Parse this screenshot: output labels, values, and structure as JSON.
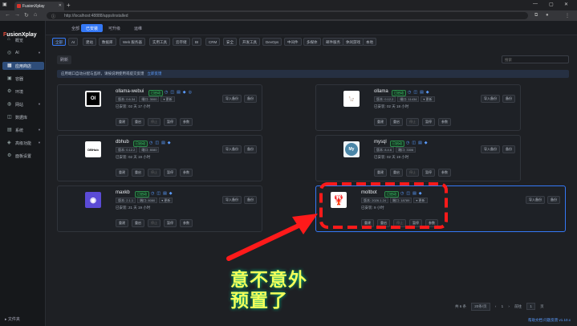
{
  "browser": {
    "tab_title": "FusionXplay",
    "url": "http://localhost:48888/apps/installed",
    "url_tag": "ⓘ"
  },
  "sidebar": {
    "logo_prefix": "F",
    "logo_text": "usionXplay",
    "items": [
      {
        "label": "概览",
        "icon": "home-icon"
      },
      {
        "label": "AI",
        "icon": "ai-icon"
      },
      {
        "label": "应用商店",
        "icon": "store-icon"
      },
      {
        "label": "容器",
        "icon": "container-icon"
      },
      {
        "label": "环境",
        "icon": "env-icon"
      },
      {
        "label": "网站",
        "icon": "web-icon"
      },
      {
        "label": "数据库",
        "icon": "database-icon"
      },
      {
        "label": "系统",
        "icon": "system-icon"
      },
      {
        "label": "高级功能",
        "icon": "advanced-icon"
      },
      {
        "label": "面板设置",
        "icon": "settings-icon"
      }
    ],
    "footer": "文件夹"
  },
  "top_tabs": [
    "全部",
    "已安装",
    "可升级",
    "运维"
  ],
  "categories": [
    "全部",
    "AI",
    "建站",
    "数据库",
    "Web 服务器",
    "实用工具",
    "云存储",
    "BI",
    "CRM",
    "安全",
    "开发工具",
    "DevOps",
    "中间件",
    "多媒体",
    "邮件服务",
    "休闲游戏",
    "本地"
  ],
  "search": {
    "left_label": "刷新",
    "placeholder": "搜索"
  },
  "notice": {
    "text": "应用端口自动分配与监听，请按说明使用或提交反馈",
    "link": "立即反馈"
  },
  "apps": [
    {
      "name": "ollama-webui",
      "status": "已启动",
      "thumb": "OI",
      "version": "版本: 0.6.34",
      "port": "端口: 3000",
      "extra": "▾ 更新",
      "uptime": "已安装: 02 天 17 小时",
      "actions": [
        "重建",
        "重启",
        "停止",
        "暂停",
        "参数"
      ],
      "right": [
        "导入备份",
        "备份"
      ]
    },
    {
      "name": "ollama",
      "status": "已启动",
      "thumb": "🦙",
      "version": "版本: 0.12.2",
      "port": "端口: 11434",
      "extra": "▾ 更新",
      "uptime": "已安装: 02 天 18 小时",
      "actions": [
        "重建",
        "重启",
        "停止",
        "暂停",
        "参数"
      ],
      "right": [
        "导入备份",
        "备份"
      ]
    },
    {
      "name": "dbhub",
      "status": "已启动",
      "thumb": "DBHub",
      "version": "版本: 0.12.2",
      "port": "端口: 8080",
      "extra": "",
      "uptime": "已安装: 02 天 19 小时",
      "actions": [
        "重建",
        "重启",
        "停止",
        "暂停",
        "参数"
      ],
      "right": [
        "导入备份",
        "备份"
      ]
    },
    {
      "name": "mysql",
      "status": "已启动",
      "thumb": "My",
      "version": "版本: 8.4.6",
      "port": "端口: 3306",
      "extra": "",
      "uptime": "已安装: 02 天 19 小时",
      "actions": [
        "重建",
        "重启",
        "停止",
        "暂停",
        "参数"
      ],
      "right": [
        "导入备份",
        "备份"
      ]
    },
    {
      "name": "maxkb",
      "status": "已启动",
      "thumb": "◉",
      "version": "版本: 2.1.1",
      "port": "端口: 8080",
      "extra": "▾ 更新",
      "uptime": "已安装: 21 天 19 小时",
      "actions": [
        "重建",
        "重启",
        "停止",
        "暂停",
        "参数"
      ],
      "right": [
        "导入备份",
        "备份"
      ]
    },
    {
      "name": "moltbot",
      "status": "已启动",
      "thumb": "🦞",
      "version": "版本: 2026.1.24",
      "port": "端口: 18789",
      "extra": "▾ 更新",
      "uptime": "已安装: 9 小时",
      "actions": [
        "重建",
        "重启",
        "停止",
        "暂停",
        "参数"
      ],
      "right": [
        "导入备份",
        "备份"
      ]
    }
  ],
  "pager": {
    "total": "共 6 条",
    "per_page": "20条/页",
    "prev": "‹",
    "page": "1",
    "next": "›",
    "goto": "前往",
    "goto_page": "1",
    "unit": "页"
  },
  "footer_right": "帮助文档  问题反馈  v1.10.x",
  "overlay": {
    "line1": "意不意外",
    "line2": "预置了",
    "accent": "#ff1a1a"
  }
}
